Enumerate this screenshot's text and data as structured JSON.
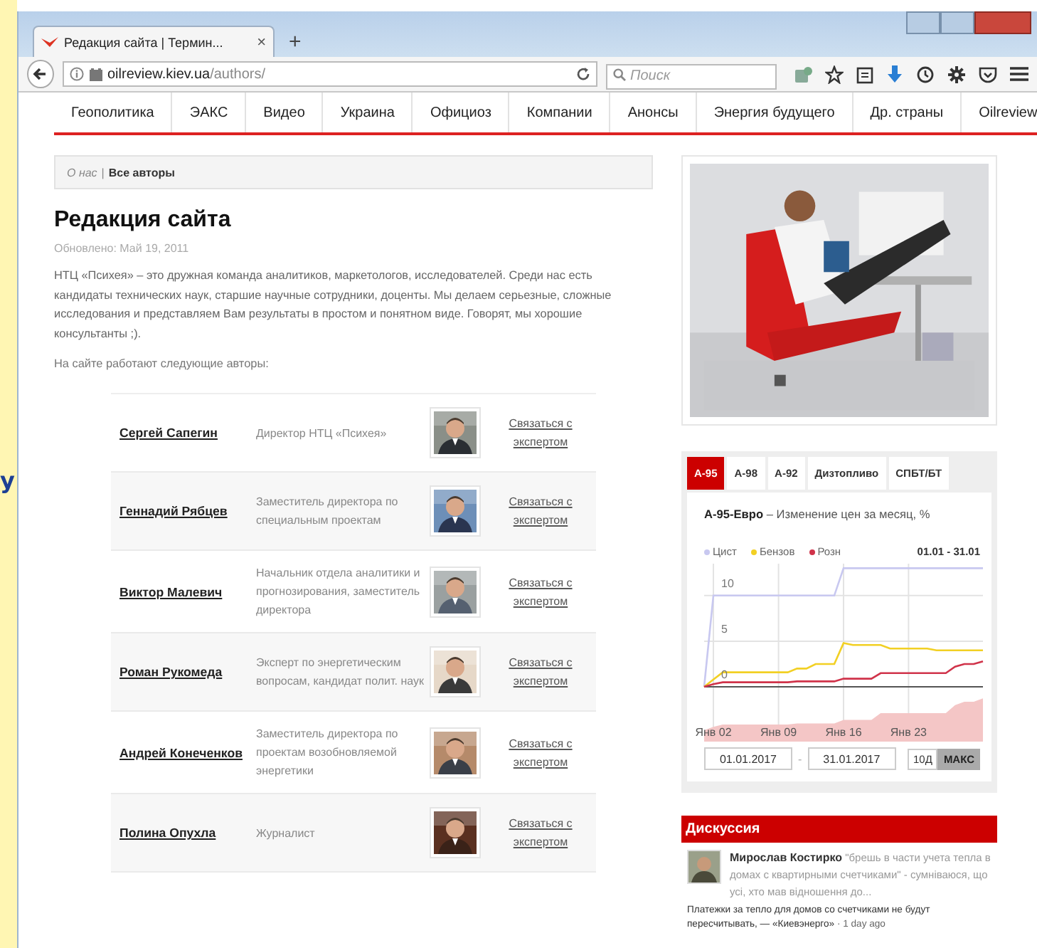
{
  "desktop": {
    "edge_text": "y"
  },
  "browser": {
    "tab": {
      "title": "Редакция сайта | Термин...",
      "close": "×"
    },
    "new_tab": "+",
    "address": {
      "host": "oilreview.kiev.ua",
      "path": "/authors/"
    },
    "search": {
      "placeholder": "Поиск"
    }
  },
  "nav": [
    {
      "label": "Геополитика"
    },
    {
      "label": "ЭАКС"
    },
    {
      "label": "Видео"
    },
    {
      "label": "Украина"
    },
    {
      "label": "Официоз"
    },
    {
      "label": "Компании"
    },
    {
      "label": "Анонсы"
    },
    {
      "label": "Энергия будущего"
    },
    {
      "label": "Др. страны"
    },
    {
      "label": "Oilreview"
    }
  ],
  "breadcrumb": {
    "parent": "О нас",
    "separator": "|",
    "current": "Все авторы"
  },
  "title": "Редакция сайта",
  "updated": "Обновлено: Май 19, 2011",
  "intro": "НТЦ «Психея» – это дружная команда аналитиков, маркетологов, исследователей. Среди нас есть кандидаты технических наук, старшие научные сотрудники, доценты. Мы делаем серьезные, сложные исследования и представляем Вам результаты в простом и понятном виде. Говорят, мы хорошие консультанты ;).",
  "authors_heading": "На сайте работают следующие авторы:",
  "authors": [
    {
      "name": "Сергей Сапегин",
      "role": "Директор НТЦ «Психея»",
      "contact": "Связаться с экспертом"
    },
    {
      "name": "Геннадий Рябцев",
      "role": "Заместитель директора по специальным проектам",
      "contact": "Связаться с экспертом"
    },
    {
      "name": "Виктор Малевич",
      "role": "Начальник отдела аналитики и прогнозирования, заместитель директора",
      "contact": "Связаться с экспертом"
    },
    {
      "name": "Роман Рукомеда",
      "role": "Эксперт по энергетическим вопросам, кандидат полит. наук",
      "contact": "Связаться с экспертом"
    },
    {
      "name": "Андрей Конеченков",
      "role": "Заместитель директора по проектам возобновляемой энергетики",
      "contact": "Связаться с экспертом"
    },
    {
      "name": "Полина Опухла",
      "role": "Журналист",
      "contact": "Связаться с экспертом"
    }
  ],
  "sidebar": {
    "fuel_tabs": [
      {
        "label": "А-95",
        "selected": true
      },
      {
        "label": "А-98",
        "selected": false
      },
      {
        "label": "А-92",
        "selected": false
      },
      {
        "label": "Дизтопливо",
        "selected": false
      },
      {
        "label": "СПБТ/БТ",
        "selected": false
      }
    ],
    "chart_title": "**А-95-Евро** – Изменение цен за месяц, %",
    "date_range": "01.01 - 31.01",
    "chart_data": {
      "type": "line",
      "categories": [
        null,
        "Янв 02",
        null,
        null,
        null,
        null,
        null,
        null,
        "Янв 09",
        null,
        null,
        null,
        null,
        null,
        null,
        "Янв 16",
        null,
        null,
        null,
        null,
        null,
        null,
        "Янв 23",
        null,
        null,
        null,
        null,
        null,
        null,
        null,
        null
      ],
      "series": [
        {
          "name": "Цист",
          "color": "#c8c8f0",
          "values": [
            0,
            10,
            10,
            10,
            10,
            10,
            10,
            10,
            10,
            10,
            10,
            10,
            10,
            10,
            10,
            13,
            13,
            13,
            13,
            13,
            13,
            13,
            13,
            13,
            13,
            13,
            13,
            13,
            13,
            13,
            13
          ]
        },
        {
          "name": "Бензов",
          "color": "#f2d024",
          "values": [
            0,
            0.8,
            1.6,
            1.6,
            1.6,
            1.6,
            1.6,
            1.6,
            1.6,
            1.6,
            2,
            2,
            2.5,
            2.5,
            2.5,
            4.8,
            4.6,
            4.6,
            4.6,
            4.6,
            4.2,
            4.2,
            4.2,
            4.2,
            4.2,
            4,
            4,
            4,
            4,
            4,
            4
          ]
        },
        {
          "name": "Розн",
          "color": "#d0334a",
          "values": [
            0,
            0.3,
            0.5,
            0.5,
            0.5,
            0.5,
            0.5,
            0.5,
            0.5,
            0.5,
            0.6,
            0.6,
            0.6,
            0.6,
            0.6,
            0.9,
            0.9,
            0.9,
            0.9,
            1.5,
            1.5,
            1.5,
            1.5,
            1.5,
            1.5,
            1.5,
            1.5,
            2.2,
            2.5,
            2.5,
            2.8
          ]
        }
      ],
      "ylim": [
        -6,
        13.5
      ],
      "yticks": [
        0,
        5,
        10
      ],
      "grid": true
    },
    "range_from": "01.01.2017",
    "range_separator": "-",
    "range_to": "31.01.2017",
    "zoom_buttons": [
      {
        "label": "10Д",
        "selected": false
      },
      {
        "label": "МАКС",
        "selected": true
      }
    ],
    "discussion": {
      "heading": "Дискуссия",
      "comments": [
        {
          "text": "**Мирослав Костирко** \"брешь в части учета тепла в домах с квартирными счетчиками\" - сумніваюся, що усі, хто мав відношення до...",
          "topic": "Платежки за тепло для домов со счетчиками не будут пересчитывать, — «Киевэнерго»",
          "separator": "·",
          "time": "1 day ago"
        }
      ]
    }
  }
}
